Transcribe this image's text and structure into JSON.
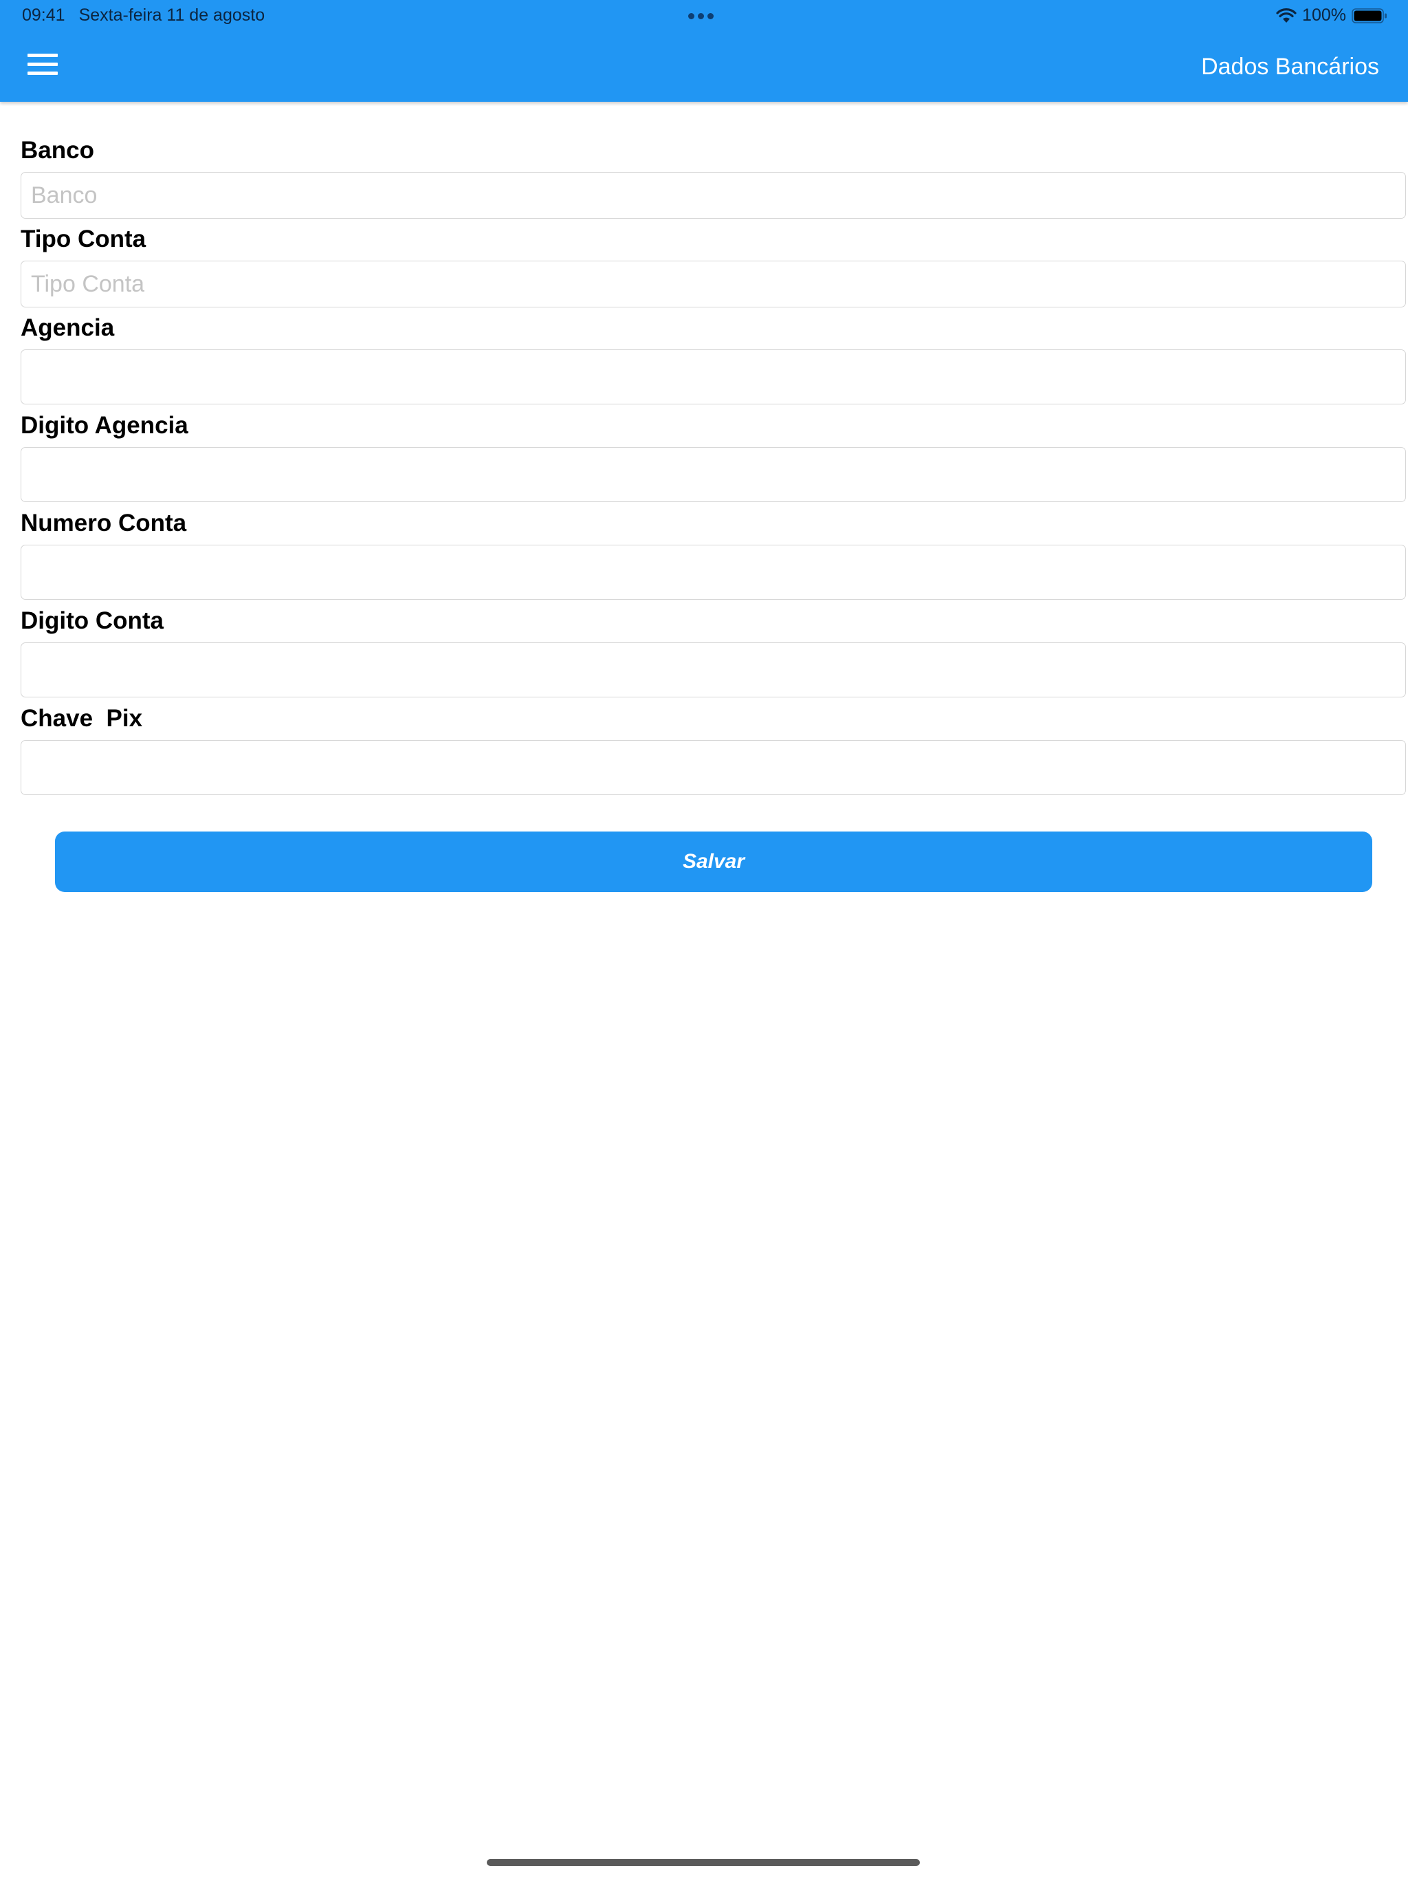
{
  "status_bar": {
    "time": "09:41",
    "date": "Sexta-feira 11 de agosto",
    "battery": "100%"
  },
  "header": {
    "title": "Dados Bancários",
    "menu_icon": "hamburger-menu-icon",
    "color": "#2196f3"
  },
  "form": {
    "fields": [
      {
        "label": "Banco",
        "placeholder": "Banco",
        "value": ""
      },
      {
        "label": "Tipo Conta",
        "placeholder": "Tipo Conta",
        "value": ""
      },
      {
        "label": "Agencia",
        "placeholder": "",
        "value": ""
      },
      {
        "label": "Digito Agencia",
        "placeholder": "",
        "value": ""
      },
      {
        "label": "Numero Conta",
        "placeholder": "",
        "value": ""
      },
      {
        "label": "Digito Conta",
        "placeholder": "",
        "value": ""
      },
      {
        "label": "Chave  Pix",
        "placeholder": "",
        "value": ""
      }
    ],
    "save_label": "Salvar"
  }
}
